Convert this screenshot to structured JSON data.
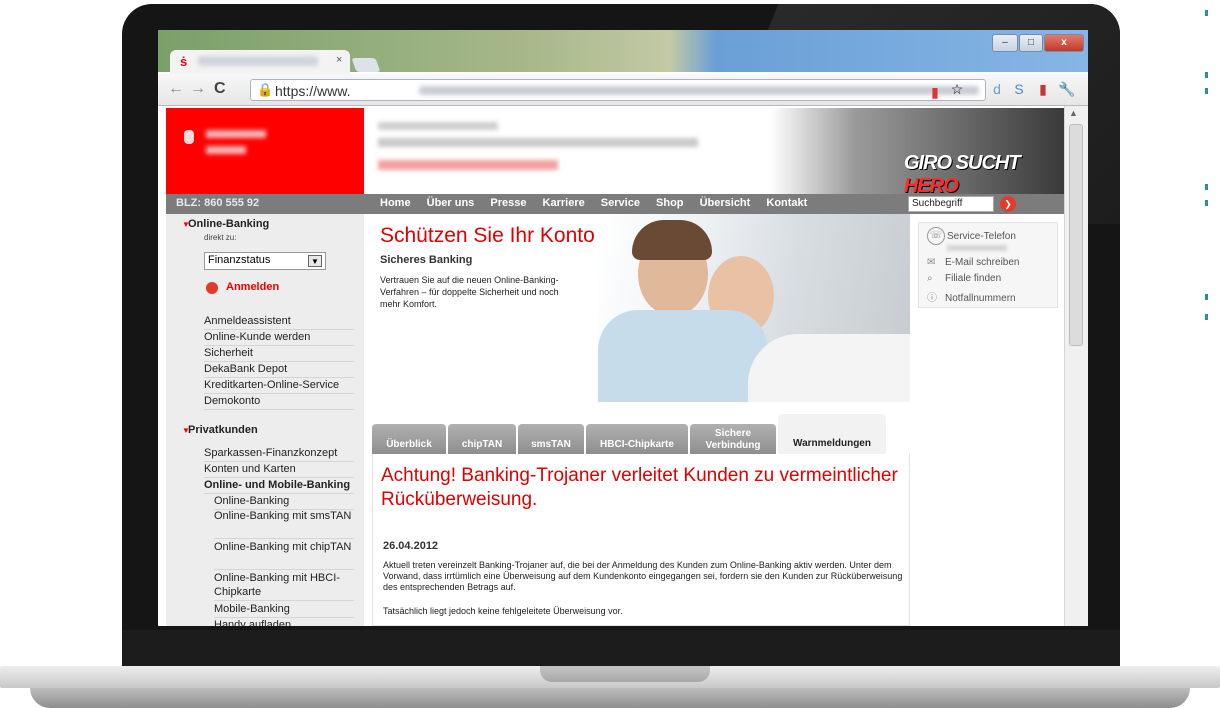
{
  "browser": {
    "tab_close": "×",
    "url_visible": "https://www.",
    "lock_icon": "lock-icon",
    "window_buttons": {
      "minimize": "–",
      "maximize": "□",
      "close": "x"
    }
  },
  "header": {
    "blz": "BLZ: 860 555 92",
    "nav": [
      "Home",
      "Über uns",
      "Presse",
      "Karriere",
      "Service",
      "Shop",
      "Übersicht",
      "Kontakt"
    ],
    "search_placeholder": "Suchbegriff",
    "banner_brand": "GIRO SUCHT",
    "banner_brand_accent": "HERO"
  },
  "sidebar": {
    "online_banking": {
      "heading": "Online-Banking",
      "direkt_label": "direkt zu:",
      "select_value": "Finanzstatus",
      "login_label": "Anmelden",
      "links": [
        "Anmeldeassistent",
        "Online-Kunde werden",
        "Sicherheit",
        "DekaBank Depot",
        "Kreditkarten-Online-Service",
        "Demokonto"
      ]
    },
    "privatkunden": {
      "heading": "Privatkunden",
      "links": [
        "Sparkassen-Finanzkonzept",
        "Konten und Karten",
        "Online- und Mobile-Banking"
      ],
      "sub_links": [
        "Online-Banking",
        "Online-Banking mit smsTAN",
        "Online-Banking mit chipTAN",
        "Online-Banking mit HBCI-Chipkarte",
        "Mobile-Banking",
        "Handy aufladen"
      ]
    }
  },
  "hero": {
    "title": "Schützen Sie Ihr Konto",
    "subtitle": "Sicheres Banking",
    "text": "Vertrauen Sie auf die neuen Online-Banking-Verfahren – für doppelte Sicherheit und noch mehr Komfort."
  },
  "tabs": [
    {
      "label": "Überblick"
    },
    {
      "label": "chipTAN"
    },
    {
      "label": "smsTAN"
    },
    {
      "label": "HBCI-Chipkarte"
    },
    {
      "label": "Sichere Verbindung"
    },
    {
      "label": "Warnmeldungen"
    }
  ],
  "article": {
    "title": "Achtung! Banking-Trojaner verleitet Kunden zu vermeintlicher Rücküberweisung.",
    "date": "26.04.2012",
    "body": "Aktuell treten vereinzelt Banking-Trojaner auf, die bei der Anmeldung des Kunden zum Online-Banking aktiv werden. Unter dem Vorwand, dass irrtümlich eine Überweisung auf dem Kundenkonto eingegangen sei, fordern sie den Kunden zur Rücküberweisung des entsprechenden Betrags auf.",
    "body2": "Tatsächlich liegt jedoch keine fehlgeleitete Überweisung vor."
  },
  "service": {
    "title": "Service-Telefon",
    "items": [
      "E-Mail schreiben",
      "Filiale finden",
      "Notfallnummern"
    ]
  },
  "colors": {
    "brand_red": "#ff0000",
    "text_red": "#e00000",
    "nav_gray": "#7c7c7c"
  }
}
